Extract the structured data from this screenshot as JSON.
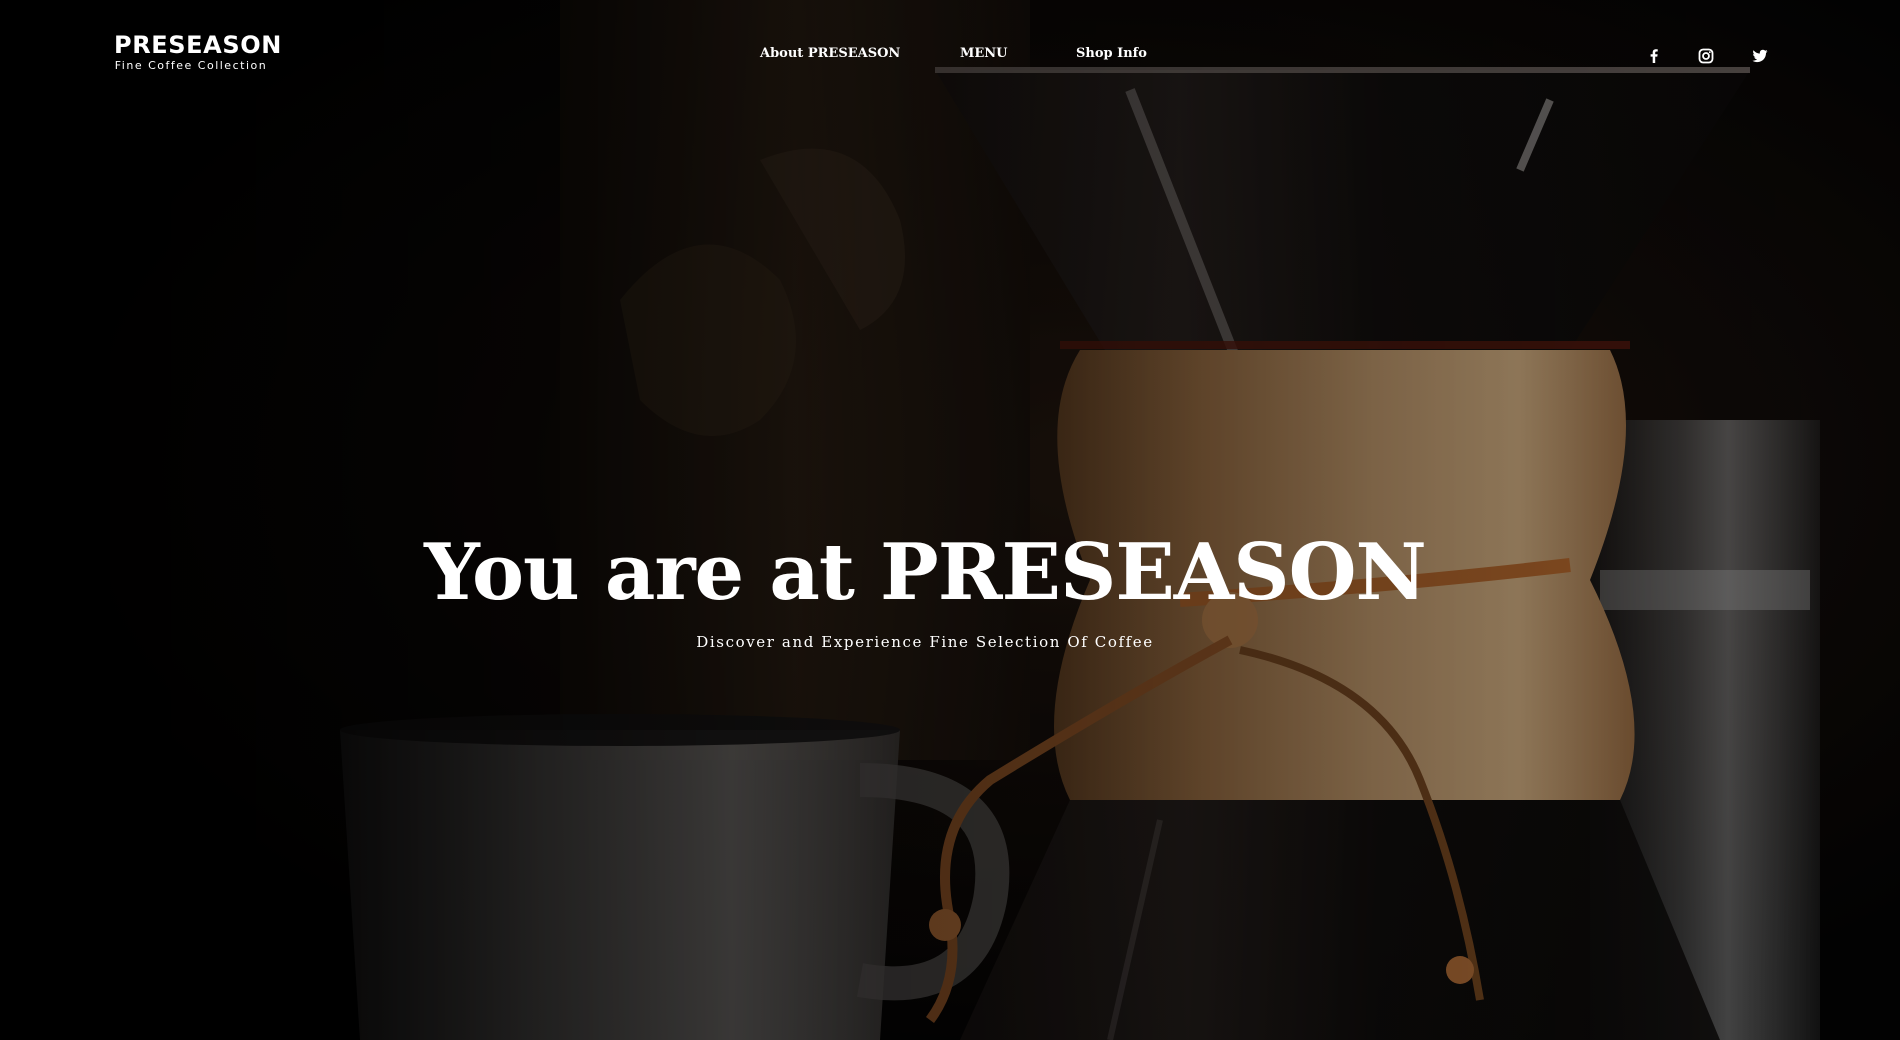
{
  "brand": {
    "title": "PRESEASON",
    "subtitle": "Fine Coffee Collection"
  },
  "nav": {
    "items": [
      "About PRESEASON",
      "MENU",
      "Shop Info"
    ]
  },
  "social": {
    "icons": [
      "facebook-icon",
      "instagram-icon",
      "twitter-icon"
    ]
  },
  "hero": {
    "title": "You are at PRESEASON",
    "subtitle": "Discover and Experience Fine Selection Of Coffee"
  },
  "colors": {
    "text": "#ffffff",
    "background": "#050404",
    "wood": "#c49a6c",
    "leather": "#b86a2e"
  }
}
